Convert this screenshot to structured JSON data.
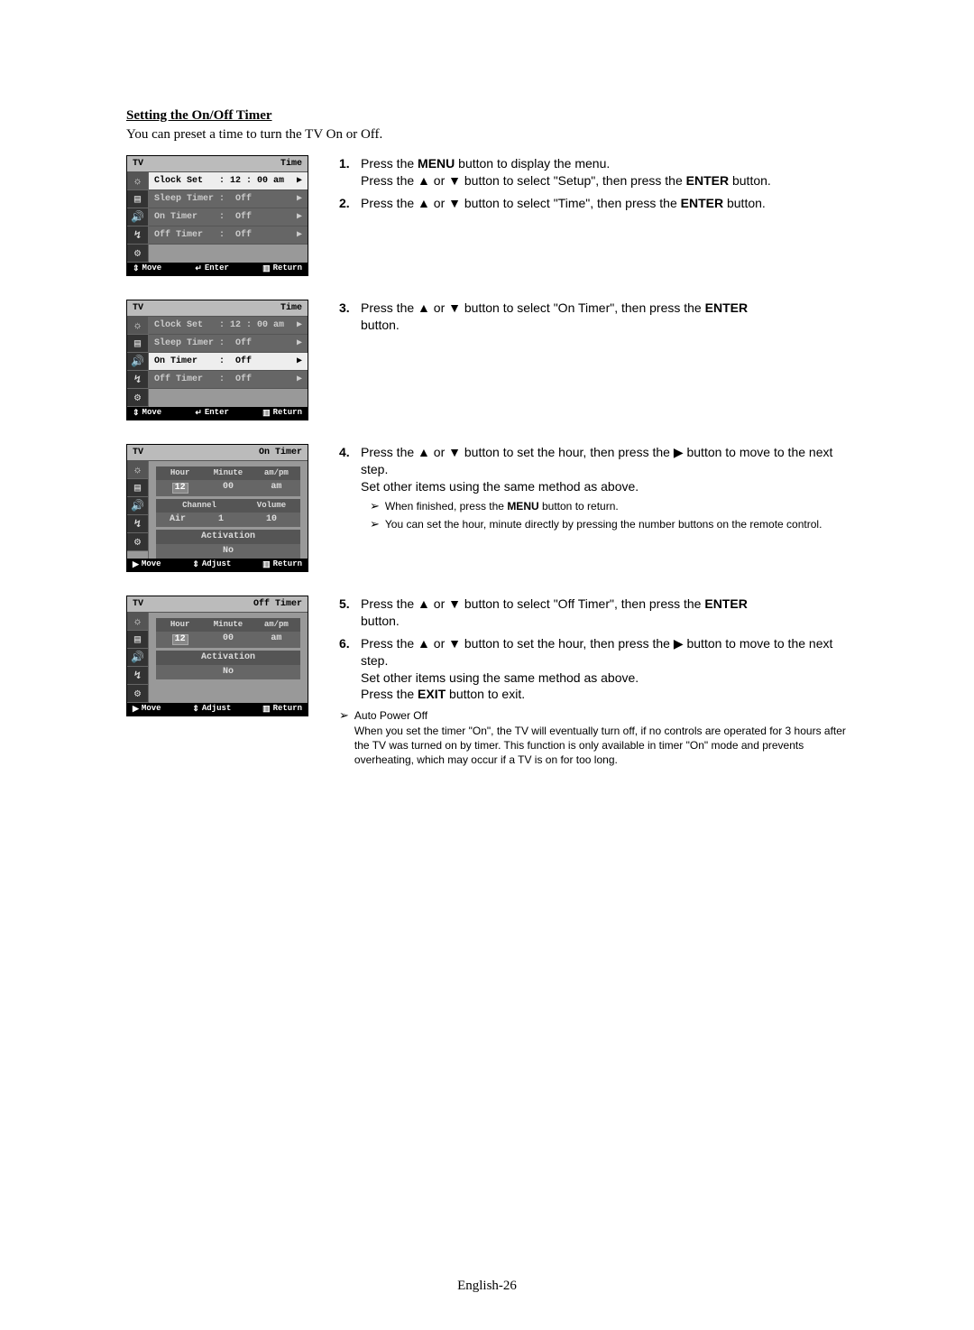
{
  "heading": "Setting the On/Off Timer",
  "intro": "You can preset a time to turn the TV On or Off.",
  "osd_common": {
    "tv": "TV",
    "title_time": "Time",
    "title_ontimer": "On Timer",
    "title_offtimer": "Off Timer",
    "move": "Move",
    "enter": "Enter",
    "return": "Return",
    "adjust": "Adjust",
    "clock_set": "Clock Set   : 12 : 00 am",
    "sleep": "Sleep Timer :  Off",
    "ontimer": "On Timer    :  Off",
    "offtimer": "Off Timer   :  Off",
    "hour": "Hour",
    "minute": "Minute",
    "ampm": "am/pm",
    "h12": "12",
    "m00": "00",
    "am": "am",
    "channel": "Channel",
    "volume": "Volume",
    "air": "Air",
    "one": "1",
    "ten": "10",
    "activation": "Activation",
    "no": "No"
  },
  "steps": {
    "s1a": "Press the ",
    "s1b": " button to display the menu.",
    "s1c": "Press the ",
    "s1d": " button to select \"Setup\", then press the ",
    "s1e": " button.",
    "s2a": "Press the ",
    "s2b": " button to select \"Time\", then press the ",
    "s2c": " button.",
    "s3a": "Press the ",
    "s3b": " button to select \"On Timer\", then press the ",
    "s3c": "button.",
    "s4a": "Press the ",
    "s4b": " button to set the hour, then press the ",
    "s4c": " button to move to the next step.",
    "s4d": "Set other items using the same method as above.",
    "s4e": "When finished, press the ",
    "s4f": " button to return.",
    "s4g": "You can set the hour, minute directly by pressing the number buttons on the remote control.",
    "s5a": "Press the ",
    "s5b": " button to select \"Off Timer\", then press the ",
    "s5c": "button.",
    "s6a": "Press the ",
    "s6b": " button to set the hour, then press the ",
    "s6c": " button to move to the next step.",
    "s6d": "Set other items using the same method as above.",
    "s6e": "Press the ",
    "s6f": " button to exit.",
    "note_t": "Auto Power Off",
    "note_b": "When you set the timer \"On\", the TV will eventually turn off, if no controls are operated for 3 hours after the TV was turned on by timer. This function is only available in timer \"On\" mode and prevents overheating, which may occur if a TV is on for too long."
  },
  "labels": {
    "menu": "MENU",
    "enter": "ENTER",
    "exit": "EXIT",
    "or": " or ",
    "up": "▲",
    "down": "▼",
    "right": "▶",
    "updown": "▲▼",
    "lr": "▶",
    "enter_icon": "↵",
    "return_icon": "▥"
  },
  "pagenum": "English-26"
}
